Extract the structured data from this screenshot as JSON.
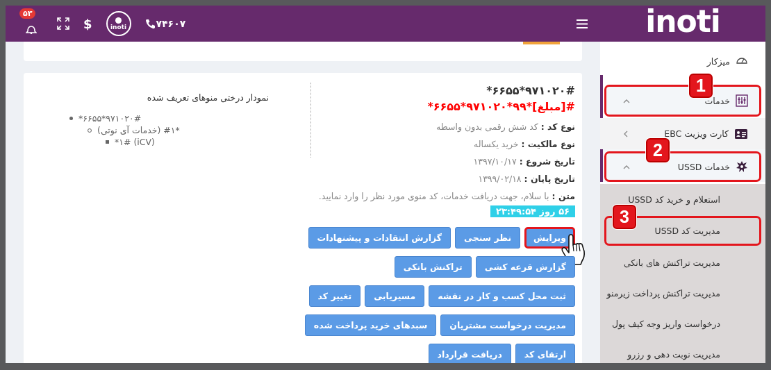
{
  "header": {
    "logo": "inoti",
    "circle_logo": "inoti",
    "currency": "$",
    "phone": "۷۴۶۰۷",
    "notification_count": "۵۳"
  },
  "sidebar": {
    "items": [
      {
        "label": "میزکار"
      },
      {
        "label": "خدمات",
        "expanded": true,
        "callout": "1",
        "children": [
          {
            "label": "کارت ویزیت EBC",
            "expanded": false
          },
          {
            "label": "خدمات USSD",
            "expanded": true,
            "callout": "2",
            "children": [
              {
                "label": "استعلام و خرید کد USSD"
              },
              {
                "label": "مدیریت کد USSD",
                "callout": "3"
              },
              {
                "label": "مدیریت تراکنش های بانکی"
              },
              {
                "label": "مدیریت تراکنش پرداخت زیرمنو"
              },
              {
                "label": "درخواست واریز وجه کیف پول"
              },
              {
                "label": "مدیریت نوبت دهی و رزرو"
              }
            ]
          }
        ]
      }
    ]
  },
  "code": {
    "main": "*۶۶۵۵*۹۷۱۰۲۰#",
    "amount_code": "#[مبلغ]*۹۹*۹۷۱۰۲۰*۶۶۵۵*",
    "details": [
      {
        "label": "نوع کد :",
        "value": "کد شش رقمی بدون واسطه"
      },
      {
        "label": "نوع مالکیت :",
        "value": "خرید یکساله"
      },
      {
        "label": "تاریخ شروع :",
        "value": "۱۳۹۷/۱۰/۱۷"
      },
      {
        "label": "تاریخ پایان :",
        "value": "۱۳۹۹/۰۲/۱۸"
      },
      {
        "label": "متن :",
        "value": "با سلام، جهت دریافت خدمات، کد منوی مورد نظر را وارد نمایید."
      }
    ],
    "timer": "۵۶ روز ۲۳:۴۹:۵۴",
    "action_rows": [
      {
        "buttons": [
          {
            "label": "ویرایش",
            "highlighted": true
          },
          {
            "label": "نظر سنجی",
            "highlighted": false
          },
          {
            "label": "گزارش انتقادات و پیشنهادات",
            "highlighted": false
          }
        ]
      },
      {
        "buttons": [
          {
            "label": "گزارش قرعه کشی",
            "highlighted": false
          },
          {
            "label": "تراکنش بانکی",
            "highlighted": false
          }
        ]
      },
      {
        "buttons": [
          {
            "label": "ثبت محل کسب و کار در نقشه",
            "highlighted": false
          },
          {
            "label": "مسیریابی",
            "highlighted": false
          },
          {
            "label": "تغییر کد",
            "highlighted": false
          }
        ]
      },
      {
        "buttons": [
          {
            "label": "مدیریت درخواست مشتریان",
            "highlighted": false
          },
          {
            "label": "سبدهای خرید پرداخت شده",
            "highlighted": false
          }
        ]
      },
      {
        "buttons": [
          {
            "label": "ارتقای کد",
            "highlighted": false
          },
          {
            "label": "دریافت قرارداد",
            "highlighted": false
          }
        ]
      }
    ]
  },
  "menu_tree": {
    "title": "نمودار درختی منوهای تعریف شده",
    "items": [
      {
        "label": "*۶۶۵۵*۹۷۱۰۲۰#",
        "children": [
          {
            "label": "*#۱ (خدمات آی نوتی)",
            "children": [
              {
                "label": "*۱# (iCV)"
              }
            ]
          }
        ]
      }
    ]
  }
}
